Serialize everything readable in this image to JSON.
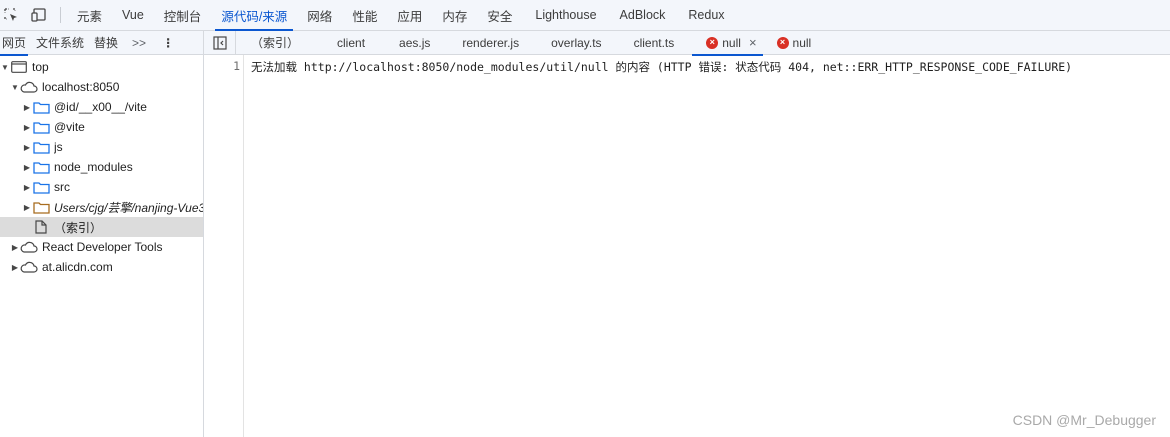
{
  "toolbar": {
    "inspect_icon": "inspect-element-icon",
    "device_icon": "device-toolbar-icon",
    "tabs": [
      "元素",
      "Vue",
      "控制台",
      "源代码/来源",
      "网络",
      "性能",
      "应用",
      "内存",
      "安全",
      "Lighthouse",
      "AdBlock",
      "Redux"
    ],
    "active_tab": "源代码/来源"
  },
  "navigator": {
    "tabs": [
      "网页",
      "文件系统",
      "替换"
    ],
    "more": ">>",
    "menu": "⋮",
    "tree": [
      {
        "label": "top",
        "icon": "frame-icon",
        "expanded": true
      },
      {
        "label": "localhost:8050",
        "icon": "cloud-icon",
        "expanded": true
      },
      {
        "label": "@id/__x00__/vite",
        "icon": "folder-icon"
      },
      {
        "label": "@vite",
        "icon": "folder-icon"
      },
      {
        "label": "js",
        "icon": "folder-icon"
      },
      {
        "label": "node_modules",
        "icon": "folder-icon"
      },
      {
        "label": "src",
        "icon": "folder-icon"
      },
      {
        "label": "Users/cjg/芸擎/nanjing-Vue3",
        "icon": "folder-icon"
      },
      {
        "label": "（索引）",
        "icon": "file-icon",
        "selected": true
      },
      {
        "label": "React Developer Tools",
        "icon": "cloud-icon"
      },
      {
        "label": "at.alicdn.com",
        "icon": "cloud-icon"
      }
    ]
  },
  "editor": {
    "toggle_icon": "sidebar-toggle-icon",
    "tabs": [
      {
        "label": "（索引）"
      },
      {
        "label": "client"
      },
      {
        "label": "aes.js"
      },
      {
        "label": "renderer.js"
      },
      {
        "label": "overlay.ts"
      },
      {
        "label": "client.ts"
      },
      {
        "label": "null",
        "error": true,
        "active": true,
        "close": "×"
      },
      {
        "label": "null",
        "error": true
      }
    ],
    "lines": [
      {
        "number": "1",
        "text": "无法加载 http://localhost:8050/node_modules/util/null 的内容 (HTTP 错误: 状态代码 404, net::ERR_HTTP_RESPONSE_CODE_FAILURE)"
      }
    ]
  },
  "watermark": "CSDN @Mr_Debugger",
  "colors": {
    "accent": "#0b57d0",
    "error": "#d93025",
    "folder_blue": "#1a73e8",
    "folder_brown": "#a86c1f",
    "selected_row": "#dcdcdc"
  }
}
